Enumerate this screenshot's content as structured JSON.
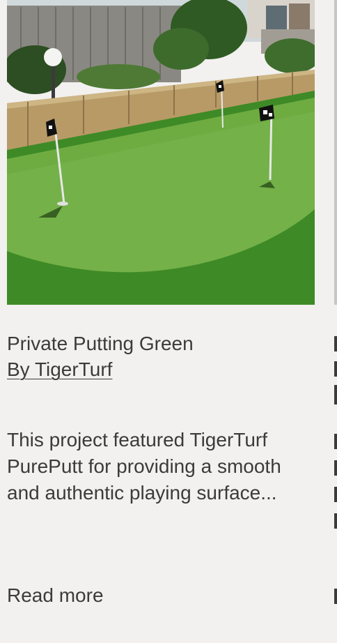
{
  "cards": [
    {
      "image_alt": "Private Putting Green",
      "title": "Private Putting Green",
      "byline": "By TigerTurf",
      "description": "This project featured TigerTurf PurePutt for providing a smooth and authentic playing surface...",
      "read_more": "Read more"
    }
  ]
}
